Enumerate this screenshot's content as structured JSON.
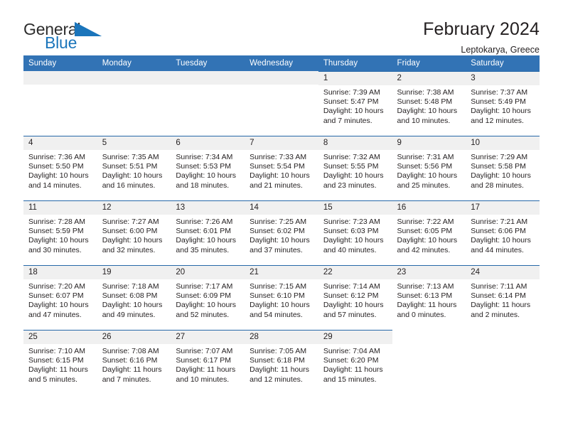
{
  "brand": {
    "name_part1": "General",
    "name_part2": "Blue",
    "triangle_color": "#1b75bb",
    "text_color": "#2d2d2d"
  },
  "header": {
    "title": "February 2024",
    "subtitle": "Leptokarya, Greece"
  },
  "theme": {
    "header_bg": "#3273b5",
    "row_border": "#2668a8",
    "daynum_bg": "#f0f0f0",
    "text": "#231f20"
  },
  "weekdays": [
    "Sunday",
    "Monday",
    "Tuesday",
    "Wednesday",
    "Thursday",
    "Friday",
    "Saturday"
  ],
  "labels": {
    "sunrise": "Sunrise:",
    "sunset": "Sunset:",
    "daylight": "Daylight:"
  },
  "weeks": [
    [
      {
        "day": "",
        "blank": true
      },
      {
        "day": "",
        "blank": true
      },
      {
        "day": "",
        "blank": true
      },
      {
        "day": "",
        "blank": true
      },
      {
        "day": "1",
        "sunrise": "Sunrise: 7:39 AM",
        "sunset": "Sunset: 5:47 PM",
        "daylight_l1": "Daylight: 10 hours",
        "daylight_l2": "and 7 minutes."
      },
      {
        "day": "2",
        "sunrise": "Sunrise: 7:38 AM",
        "sunset": "Sunset: 5:48 PM",
        "daylight_l1": "Daylight: 10 hours",
        "daylight_l2": "and 10 minutes."
      },
      {
        "day": "3",
        "sunrise": "Sunrise: 7:37 AM",
        "sunset": "Sunset: 5:49 PM",
        "daylight_l1": "Daylight: 10 hours",
        "daylight_l2": "and 12 minutes."
      }
    ],
    [
      {
        "day": "4",
        "sunrise": "Sunrise: 7:36 AM",
        "sunset": "Sunset: 5:50 PM",
        "daylight_l1": "Daylight: 10 hours",
        "daylight_l2": "and 14 minutes."
      },
      {
        "day": "5",
        "sunrise": "Sunrise: 7:35 AM",
        "sunset": "Sunset: 5:51 PM",
        "daylight_l1": "Daylight: 10 hours",
        "daylight_l2": "and 16 minutes."
      },
      {
        "day": "6",
        "sunrise": "Sunrise: 7:34 AM",
        "sunset": "Sunset: 5:53 PM",
        "daylight_l1": "Daylight: 10 hours",
        "daylight_l2": "and 18 minutes."
      },
      {
        "day": "7",
        "sunrise": "Sunrise: 7:33 AM",
        "sunset": "Sunset: 5:54 PM",
        "daylight_l1": "Daylight: 10 hours",
        "daylight_l2": "and 21 minutes."
      },
      {
        "day": "8",
        "sunrise": "Sunrise: 7:32 AM",
        "sunset": "Sunset: 5:55 PM",
        "daylight_l1": "Daylight: 10 hours",
        "daylight_l2": "and 23 minutes."
      },
      {
        "day": "9",
        "sunrise": "Sunrise: 7:31 AM",
        "sunset": "Sunset: 5:56 PM",
        "daylight_l1": "Daylight: 10 hours",
        "daylight_l2": "and 25 minutes."
      },
      {
        "day": "10",
        "sunrise": "Sunrise: 7:29 AM",
        "sunset": "Sunset: 5:58 PM",
        "daylight_l1": "Daylight: 10 hours",
        "daylight_l2": "and 28 minutes."
      }
    ],
    [
      {
        "day": "11",
        "sunrise": "Sunrise: 7:28 AM",
        "sunset": "Sunset: 5:59 PM",
        "daylight_l1": "Daylight: 10 hours",
        "daylight_l2": "and 30 minutes."
      },
      {
        "day": "12",
        "sunrise": "Sunrise: 7:27 AM",
        "sunset": "Sunset: 6:00 PM",
        "daylight_l1": "Daylight: 10 hours",
        "daylight_l2": "and 32 minutes."
      },
      {
        "day": "13",
        "sunrise": "Sunrise: 7:26 AM",
        "sunset": "Sunset: 6:01 PM",
        "daylight_l1": "Daylight: 10 hours",
        "daylight_l2": "and 35 minutes."
      },
      {
        "day": "14",
        "sunrise": "Sunrise: 7:25 AM",
        "sunset": "Sunset: 6:02 PM",
        "daylight_l1": "Daylight: 10 hours",
        "daylight_l2": "and 37 minutes."
      },
      {
        "day": "15",
        "sunrise": "Sunrise: 7:23 AM",
        "sunset": "Sunset: 6:03 PM",
        "daylight_l1": "Daylight: 10 hours",
        "daylight_l2": "and 40 minutes."
      },
      {
        "day": "16",
        "sunrise": "Sunrise: 7:22 AM",
        "sunset": "Sunset: 6:05 PM",
        "daylight_l1": "Daylight: 10 hours",
        "daylight_l2": "and 42 minutes."
      },
      {
        "day": "17",
        "sunrise": "Sunrise: 7:21 AM",
        "sunset": "Sunset: 6:06 PM",
        "daylight_l1": "Daylight: 10 hours",
        "daylight_l2": "and 44 minutes."
      }
    ],
    [
      {
        "day": "18",
        "sunrise": "Sunrise: 7:20 AM",
        "sunset": "Sunset: 6:07 PM",
        "daylight_l1": "Daylight: 10 hours",
        "daylight_l2": "and 47 minutes."
      },
      {
        "day": "19",
        "sunrise": "Sunrise: 7:18 AM",
        "sunset": "Sunset: 6:08 PM",
        "daylight_l1": "Daylight: 10 hours",
        "daylight_l2": "and 49 minutes."
      },
      {
        "day": "20",
        "sunrise": "Sunrise: 7:17 AM",
        "sunset": "Sunset: 6:09 PM",
        "daylight_l1": "Daylight: 10 hours",
        "daylight_l2": "and 52 minutes."
      },
      {
        "day": "21",
        "sunrise": "Sunrise: 7:15 AM",
        "sunset": "Sunset: 6:10 PM",
        "daylight_l1": "Daylight: 10 hours",
        "daylight_l2": "and 54 minutes."
      },
      {
        "day": "22",
        "sunrise": "Sunrise: 7:14 AM",
        "sunset": "Sunset: 6:12 PM",
        "daylight_l1": "Daylight: 10 hours",
        "daylight_l2": "and 57 minutes."
      },
      {
        "day": "23",
        "sunrise": "Sunrise: 7:13 AM",
        "sunset": "Sunset: 6:13 PM",
        "daylight_l1": "Daylight: 11 hours",
        "daylight_l2": "and 0 minutes."
      },
      {
        "day": "24",
        "sunrise": "Sunrise: 7:11 AM",
        "sunset": "Sunset: 6:14 PM",
        "daylight_l1": "Daylight: 11 hours",
        "daylight_l2": "and 2 minutes."
      }
    ],
    [
      {
        "day": "25",
        "sunrise": "Sunrise: 7:10 AM",
        "sunset": "Sunset: 6:15 PM",
        "daylight_l1": "Daylight: 11 hours",
        "daylight_l2": "and 5 minutes."
      },
      {
        "day": "26",
        "sunrise": "Sunrise: 7:08 AM",
        "sunset": "Sunset: 6:16 PM",
        "daylight_l1": "Daylight: 11 hours",
        "daylight_l2": "and 7 minutes."
      },
      {
        "day": "27",
        "sunrise": "Sunrise: 7:07 AM",
        "sunset": "Sunset: 6:17 PM",
        "daylight_l1": "Daylight: 11 hours",
        "daylight_l2": "and 10 minutes."
      },
      {
        "day": "28",
        "sunrise": "Sunrise: 7:05 AM",
        "sunset": "Sunset: 6:18 PM",
        "daylight_l1": "Daylight: 11 hours",
        "daylight_l2": "and 12 minutes."
      },
      {
        "day": "29",
        "sunrise": "Sunrise: 7:04 AM",
        "sunset": "Sunset: 6:20 PM",
        "daylight_l1": "Daylight: 11 hours",
        "daylight_l2": "and 15 minutes."
      },
      {
        "day": "",
        "empty": true
      },
      {
        "day": "",
        "empty": true
      }
    ]
  ]
}
